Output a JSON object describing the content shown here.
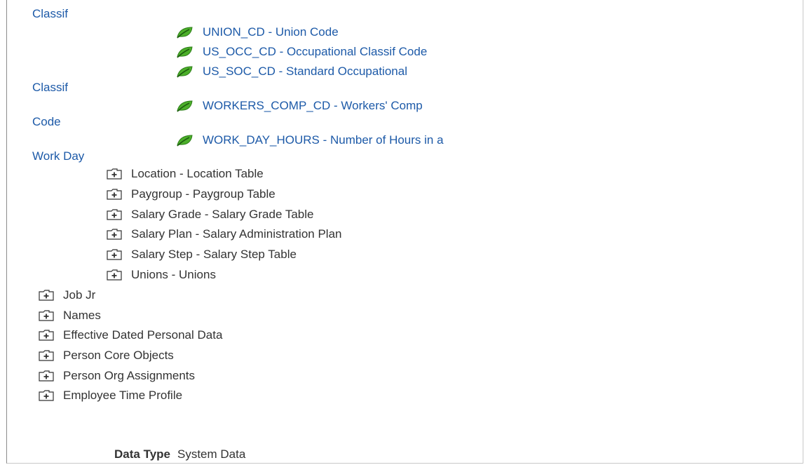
{
  "tree": {
    "field_wraps": [
      "Classif",
      "Classif",
      "Code",
      "Work Day"
    ],
    "fields": [
      {
        "text": "UNION_CD - Union Code"
      },
      {
        "text": "US_OCC_CD - Occupational Classif Code"
      },
      {
        "text": "US_SOC_CD - Standard Occupational"
      },
      {
        "text": "WORKERS_COMP_CD - Workers' Comp"
      },
      {
        "text": "WORK_DAY_HOURS - Number of Hours in a"
      }
    ],
    "child_records": [
      "Location - Location Table",
      "Paygroup - Paygroup Table",
      "Salary Grade - Salary Grade Table",
      "Salary Plan - Salary Administration Plan",
      "Salary Step - Salary Step Table",
      "Unions - Unions"
    ],
    "top_records": [
      "Job Jr",
      "Names",
      "Effective Dated Personal Data",
      "Person Core Objects",
      "Person Org Assignments",
      "Employee Time Profile"
    ]
  },
  "footer": {
    "data_type_label": "Data Type",
    "data_type_value": "System Data"
  },
  "colors": {
    "link": "#1d5aa8",
    "leaf_icon": "#4caf2a",
    "text": "#333333"
  },
  "icons": {
    "field": "leaf-icon",
    "record": "folder-plus-icon"
  }
}
